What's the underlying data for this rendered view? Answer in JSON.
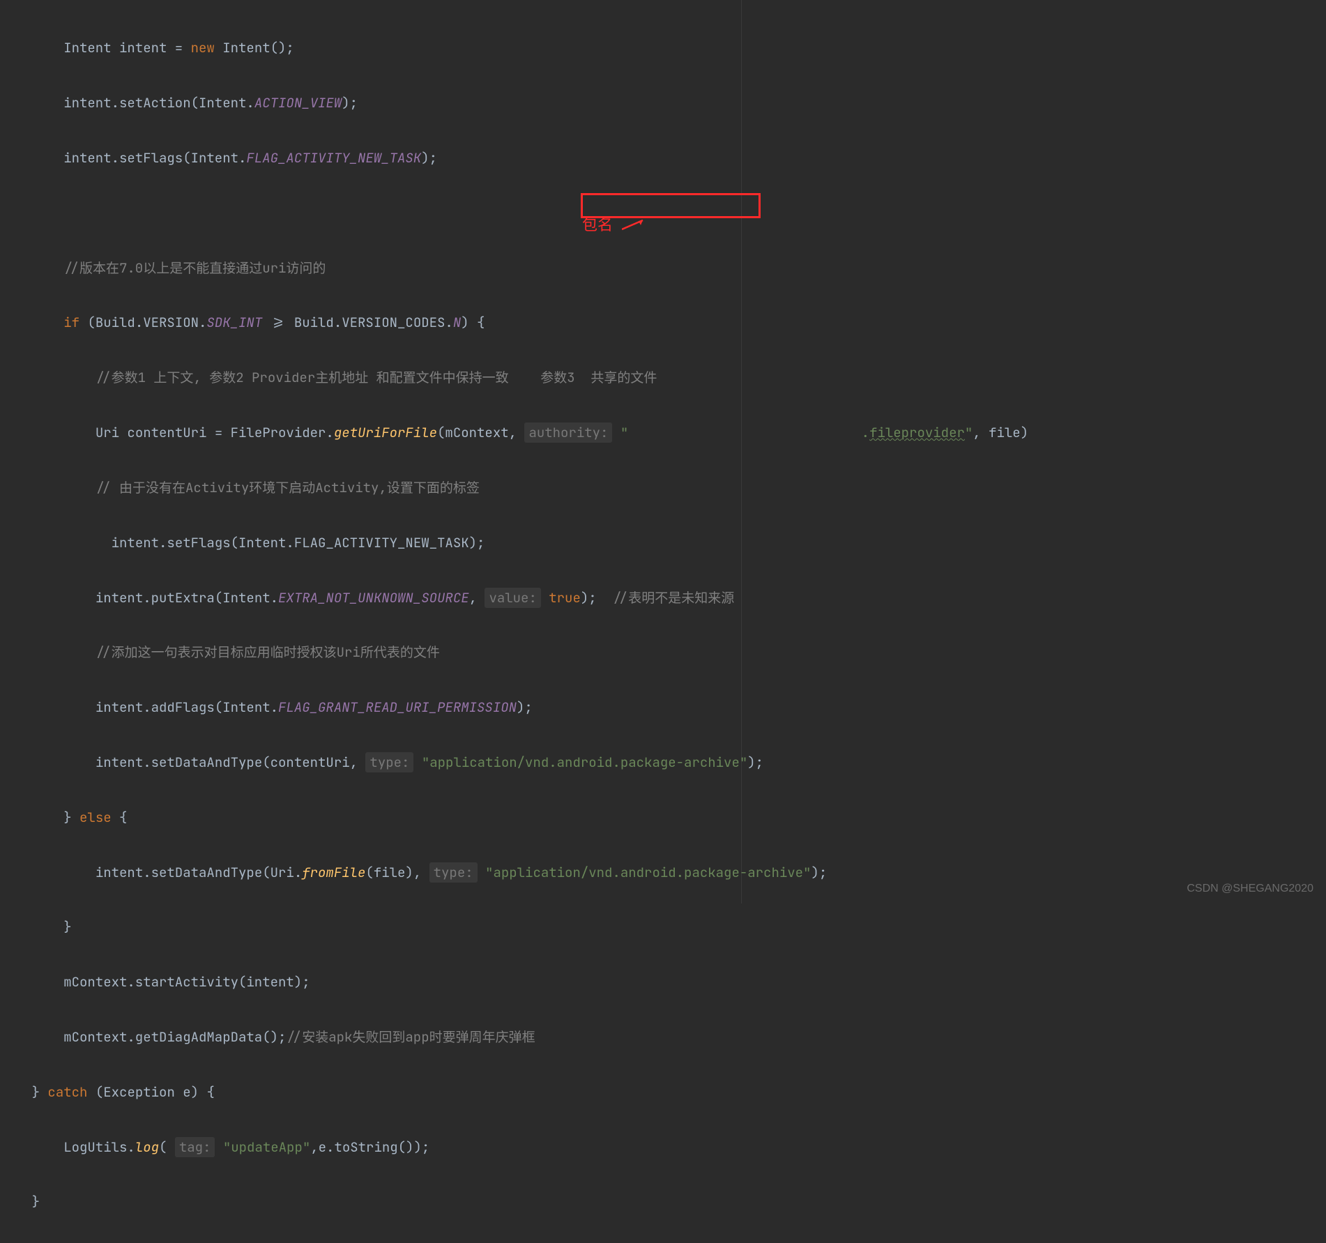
{
  "watermark": "CSDN @SHEGANG2020",
  "code": {
    "l1_a": "Intent intent = ",
    "l1_kw": "new",
    "l1_b": " Intent();",
    "l2": "intent.setAction(Intent.",
    "l2_sf": "ACTION_VIEW",
    "l2_end": ");",
    "l3": "intent.setFlags(Intent.",
    "l3_sf": "FLAG_ACTIVITY_NEW_TASK",
    "l3_end": ");",
    "l5_comment": "//版本在7.0以上是不能直接通过uri访问的",
    "l6_if": "if",
    "l6_a": " (Build.VERSION.",
    "l6_sf": "SDK_INT",
    "l6_b": " >= Build.VERSION_CODES.",
    "l6_sf2": "N",
    "l6_c": ") {",
    "l7_comment": "//参数1 上下文, 参数2 Provider主机地址 和配置文件中保持一致    参数3  共享的文件",
    "l8_a": "Uri contentUri = FileProvider.",
    "l8_sm": "getUriForFile",
    "l8_b": "(mContext, ",
    "l8_hint": "authority:",
    "l8_str1": " \"",
    "l8_str2": ".",
    "l8_str3": "fileprovider",
    "l8_str4": "\"",
    "l8_c": ", file)",
    "l9_comment": "// 由于没有在Activity环境下启动Activity,设置下面的标签",
    "l10": "  intent.setFlags(Intent.FLAG_ACTIVITY_NEW_TASK);",
    "l11_a": "intent.putExtra(Intent.",
    "l11_sf": "EXTRA_NOT_UNKNOWN_SOURCE",
    "l11_b": ", ",
    "l11_hint": "value:",
    "l11_c": " ",
    "l11_kw": "true",
    "l11_d": ");  ",
    "l11_comment": "//表明不是未知来源",
    "l12_comment": "//添加这一句表示对目标应用临时授权该Uri所代表的文件",
    "l13_a": "intent.addFlags(Intent.",
    "l13_sf": "FLAG_GRANT_READ_URI_PERMISSION",
    "l13_b": ");",
    "l14_a": "intent.setDataAndType(contentUri, ",
    "l14_hint": "type:",
    "l14_b": " ",
    "l14_str": "\"application/vnd.android.package-archive\"",
    "l14_c": ");",
    "l15_a": "} ",
    "l15_kw": "else",
    "l15_b": " {",
    "l16_a": "intent.setDataAndType(Uri.",
    "l16_sm": "fromFile",
    "l16_b": "(file), ",
    "l16_hint": "type:",
    "l16_c": " ",
    "l16_str": "\"application/vnd.android.package-archive\"",
    "l16_d": ");",
    "l17": "}",
    "l18": "mContext.startActivity(intent);",
    "l19_a": "mContext.getDiagAdMapData();",
    "l19_comment": "//安装apk失败回到app时要弹周年庆弹框",
    "l20_a": "} ",
    "l20_kw": "catch",
    "l20_b": " (Exception e) {",
    "l21_a": "LogUtils.",
    "l21_sm": "log",
    "l21_b": "( ",
    "l21_hint": "tag:",
    "l21_c": " ",
    "l21_str": "\"updateApp\"",
    "l21_d": ",e.toString());",
    "l22": "}"
  },
  "annotation": {
    "red_text": "包名"
  }
}
